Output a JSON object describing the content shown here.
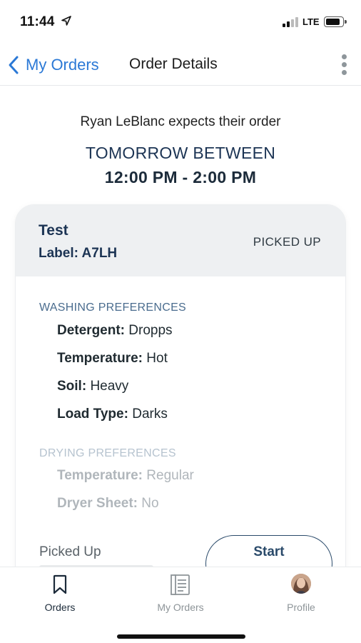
{
  "status_bar": {
    "time": "11:44",
    "network": "LTE"
  },
  "nav": {
    "back_label": "My Orders",
    "title": "Order Details"
  },
  "header": {
    "expects_text": "Ryan LeBlanc expects their order",
    "window_line1": "TOMORROW BETWEEN",
    "window_line2": "12:00 PM - 2:00 PM"
  },
  "order": {
    "title": "Test",
    "label": "Label: A7LH",
    "status": "PICKED UP",
    "washing": {
      "heading": "WASHING PREFERENCES",
      "items": [
        {
          "key": "Detergent:",
          "value": "Dropps"
        },
        {
          "key": "Temperature:",
          "value": "Hot"
        },
        {
          "key": "Soil:",
          "value": "Heavy"
        },
        {
          "key": "Load Type:",
          "value": "Darks"
        }
      ]
    },
    "drying": {
      "heading": "DRYING PREFERENCES",
      "items": [
        {
          "key": "Temperature:",
          "value": "Regular"
        },
        {
          "key": "Dryer Sheet:",
          "value": "No"
        }
      ]
    },
    "step_label": "Picked Up",
    "start_button": "Start"
  },
  "tab_bar": {
    "tabs": [
      {
        "label": "Orders",
        "icon": "bookmark-icon",
        "active": true
      },
      {
        "label": "My Orders",
        "icon": "list-document-icon",
        "active": false
      },
      {
        "label": "Profile",
        "icon": "avatar",
        "active": false
      }
    ]
  },
  "colors": {
    "accent": "#2b79d6",
    "navy": "#1c3454",
    "muted": "#b0b6bb",
    "card_header_bg": "#eef0f2"
  }
}
